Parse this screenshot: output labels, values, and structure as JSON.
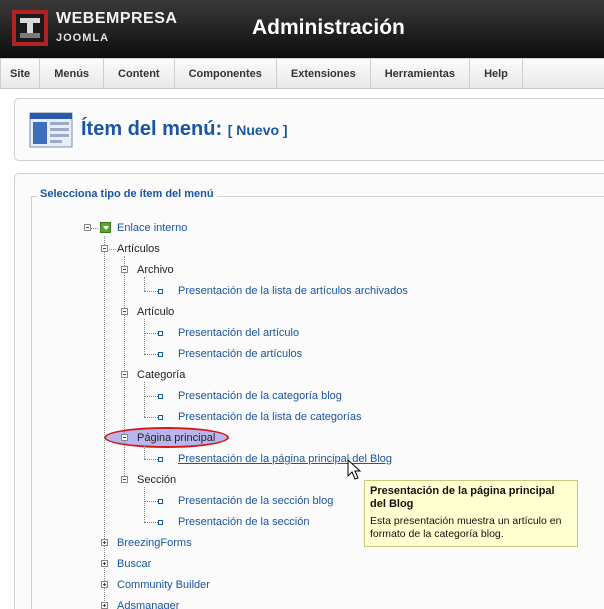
{
  "header": {
    "brand": "WEBEMPRESA",
    "brand_sub": "JOOMLA",
    "title": "Administración"
  },
  "menubar": {
    "items": [
      "Site",
      "Menús",
      "Content",
      "Componentes",
      "Extensiones",
      "Herramientas",
      "Help"
    ]
  },
  "page": {
    "title": "Ítem del menú:",
    "subtitle": "[ Nuevo ]"
  },
  "panel": {
    "legend": "Selecciona tipo de ítem del menú"
  },
  "tree": {
    "root": "Enlace interno",
    "articulos": "Artículos",
    "archivo": "Archivo",
    "archivo_items": [
      "Presentación de la lista de artículos archivados"
    ],
    "articulo": "Artículo",
    "articulo_items": [
      "Presentación del artículo",
      "Presentación de artículos"
    ],
    "categoria": "Categoría",
    "categoria_items": [
      "Presentación de la categoría blog",
      "Presentación de la lista de categorías"
    ],
    "pagina_principal": "Página principal",
    "pagina_items": [
      "Presentación de la página principal del Blog"
    ],
    "seccion": "Sección",
    "seccion_items": [
      "Presentación de la sección blog",
      "Presentación de la sección"
    ],
    "components": [
      "BreezingForms",
      "Buscar",
      "Community Builder",
      "Adsmanager"
    ]
  },
  "tooltip": {
    "title": "Presentación de la página principal del Blog",
    "body": "Esta presentación muestra un artículo en formato de la categoría blog."
  },
  "colors": {
    "link": "#1a55a3",
    "highlight_ring": "#d41818",
    "highlight_fill": "#b8b6ee",
    "tooltip_bg": "#ffffd0"
  }
}
